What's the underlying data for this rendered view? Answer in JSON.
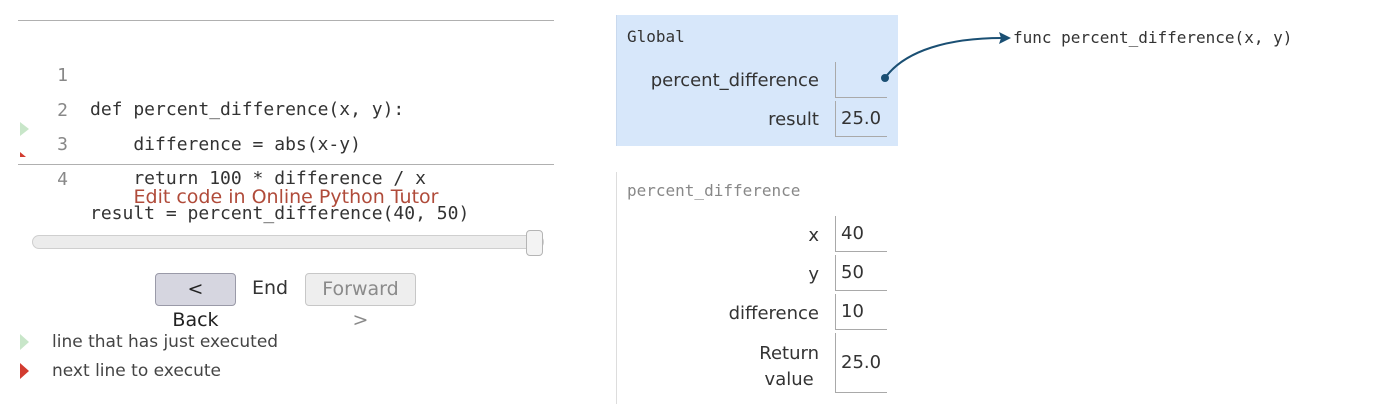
{
  "code": {
    "lines": [
      {
        "no": "1",
        "text": "def percent_difference(x, y):"
      },
      {
        "no": "2",
        "text": "    difference = abs(x-y)"
      },
      {
        "no": "3",
        "text": "    return 100 * difference / x"
      },
      {
        "no": "4",
        "text": "result = percent_difference(40, 50)"
      }
    ]
  },
  "edit_link": "Edit code in Online Python Tutor",
  "slider": {
    "position": 1.0
  },
  "nav": {
    "back": "< Back",
    "status": "End",
    "forward": "Forward >"
  },
  "legend": {
    "executed": "line that has just executed",
    "next": "next line to execute"
  },
  "global_frame": {
    "title": "Global",
    "vars": [
      {
        "name": "percent_difference",
        "value": ""
      },
      {
        "name": "result",
        "value": "25.0"
      }
    ]
  },
  "local_frame": {
    "title": "percent_difference",
    "vars": [
      {
        "name": "x",
        "value": "40"
      },
      {
        "name": "y",
        "value": "50"
      },
      {
        "name": "difference",
        "value": "10"
      }
    ],
    "return": {
      "label_line1": "Return",
      "label_line2": "value",
      "value": "25.0"
    }
  },
  "heap": {
    "func": "func percent_difference(x, y)"
  },
  "colors": {
    "global_frame_bg": "#d7e7fa",
    "pointer": "#1a4f73",
    "link": "#b04b3a",
    "just_executed_arrow": "#c8e6c9",
    "next_line_arrow": "#d23c30"
  }
}
